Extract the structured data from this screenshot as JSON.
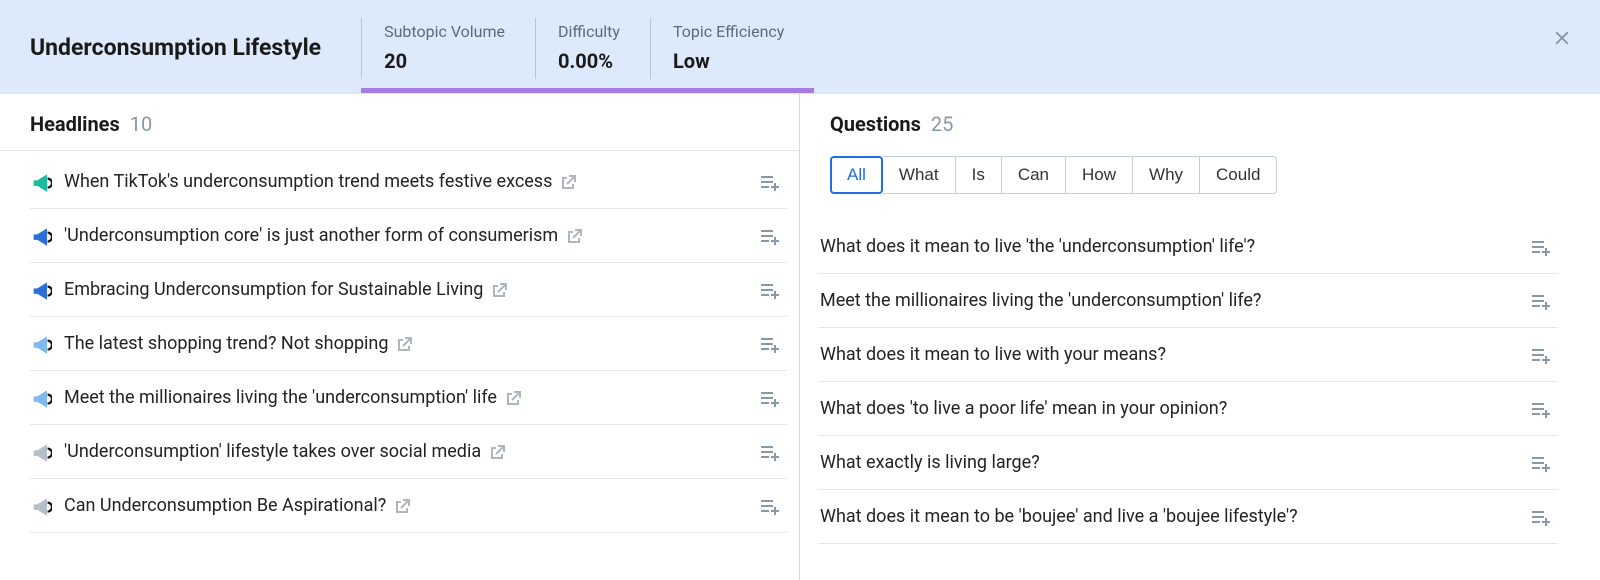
{
  "header": {
    "title": "Underconsumption Lifestyle",
    "metrics": [
      {
        "label": "Subtopic Volume",
        "value": "20"
      },
      {
        "label": "Difficulty",
        "value": "0.00%"
      },
      {
        "label": "Topic Efficiency",
        "value": "Low"
      }
    ]
  },
  "headlines": {
    "title": "Headlines",
    "count": "10",
    "items": [
      {
        "text": "When TikTok's underconsumption trend meets festive excess",
        "icon_color": "#1abc9c"
      },
      {
        "text": "'Underconsumption core' is just another form of consumerism",
        "icon_color": "#2b6fd6"
      },
      {
        "text": "Embracing Underconsumption for Sustainable Living",
        "icon_color": "#2b6fd6"
      },
      {
        "text": "The latest shopping trend? Not shopping",
        "icon_color": "#7fb9ef"
      },
      {
        "text": "Meet the millionaires living the 'underconsumption' life",
        "icon_color": "#7fb9ef"
      },
      {
        "text": "'Underconsumption' lifestyle takes over social media",
        "icon_color": "#b6bec7"
      },
      {
        "text": "Can Underconsumption Be Aspirational?",
        "icon_color": "#b6bec7"
      }
    ]
  },
  "questions": {
    "title": "Questions",
    "count": "25",
    "filters": [
      "All",
      "What",
      "Is",
      "Can",
      "How",
      "Why",
      "Could"
    ],
    "active_filter": "All",
    "items": [
      {
        "text": "What does it mean to live 'the 'underconsumption' life'?"
      },
      {
        "text": "Meet the millionaires living the 'underconsumption' life?"
      },
      {
        "text": "What does it mean to live with your means?"
      },
      {
        "text": "What does 'to live a poor life' mean in your opinion?"
      },
      {
        "text": "What exactly is living large?"
      },
      {
        "text": "What does it mean to be 'boujee' and live a 'boujee lifestyle'?"
      }
    ]
  }
}
